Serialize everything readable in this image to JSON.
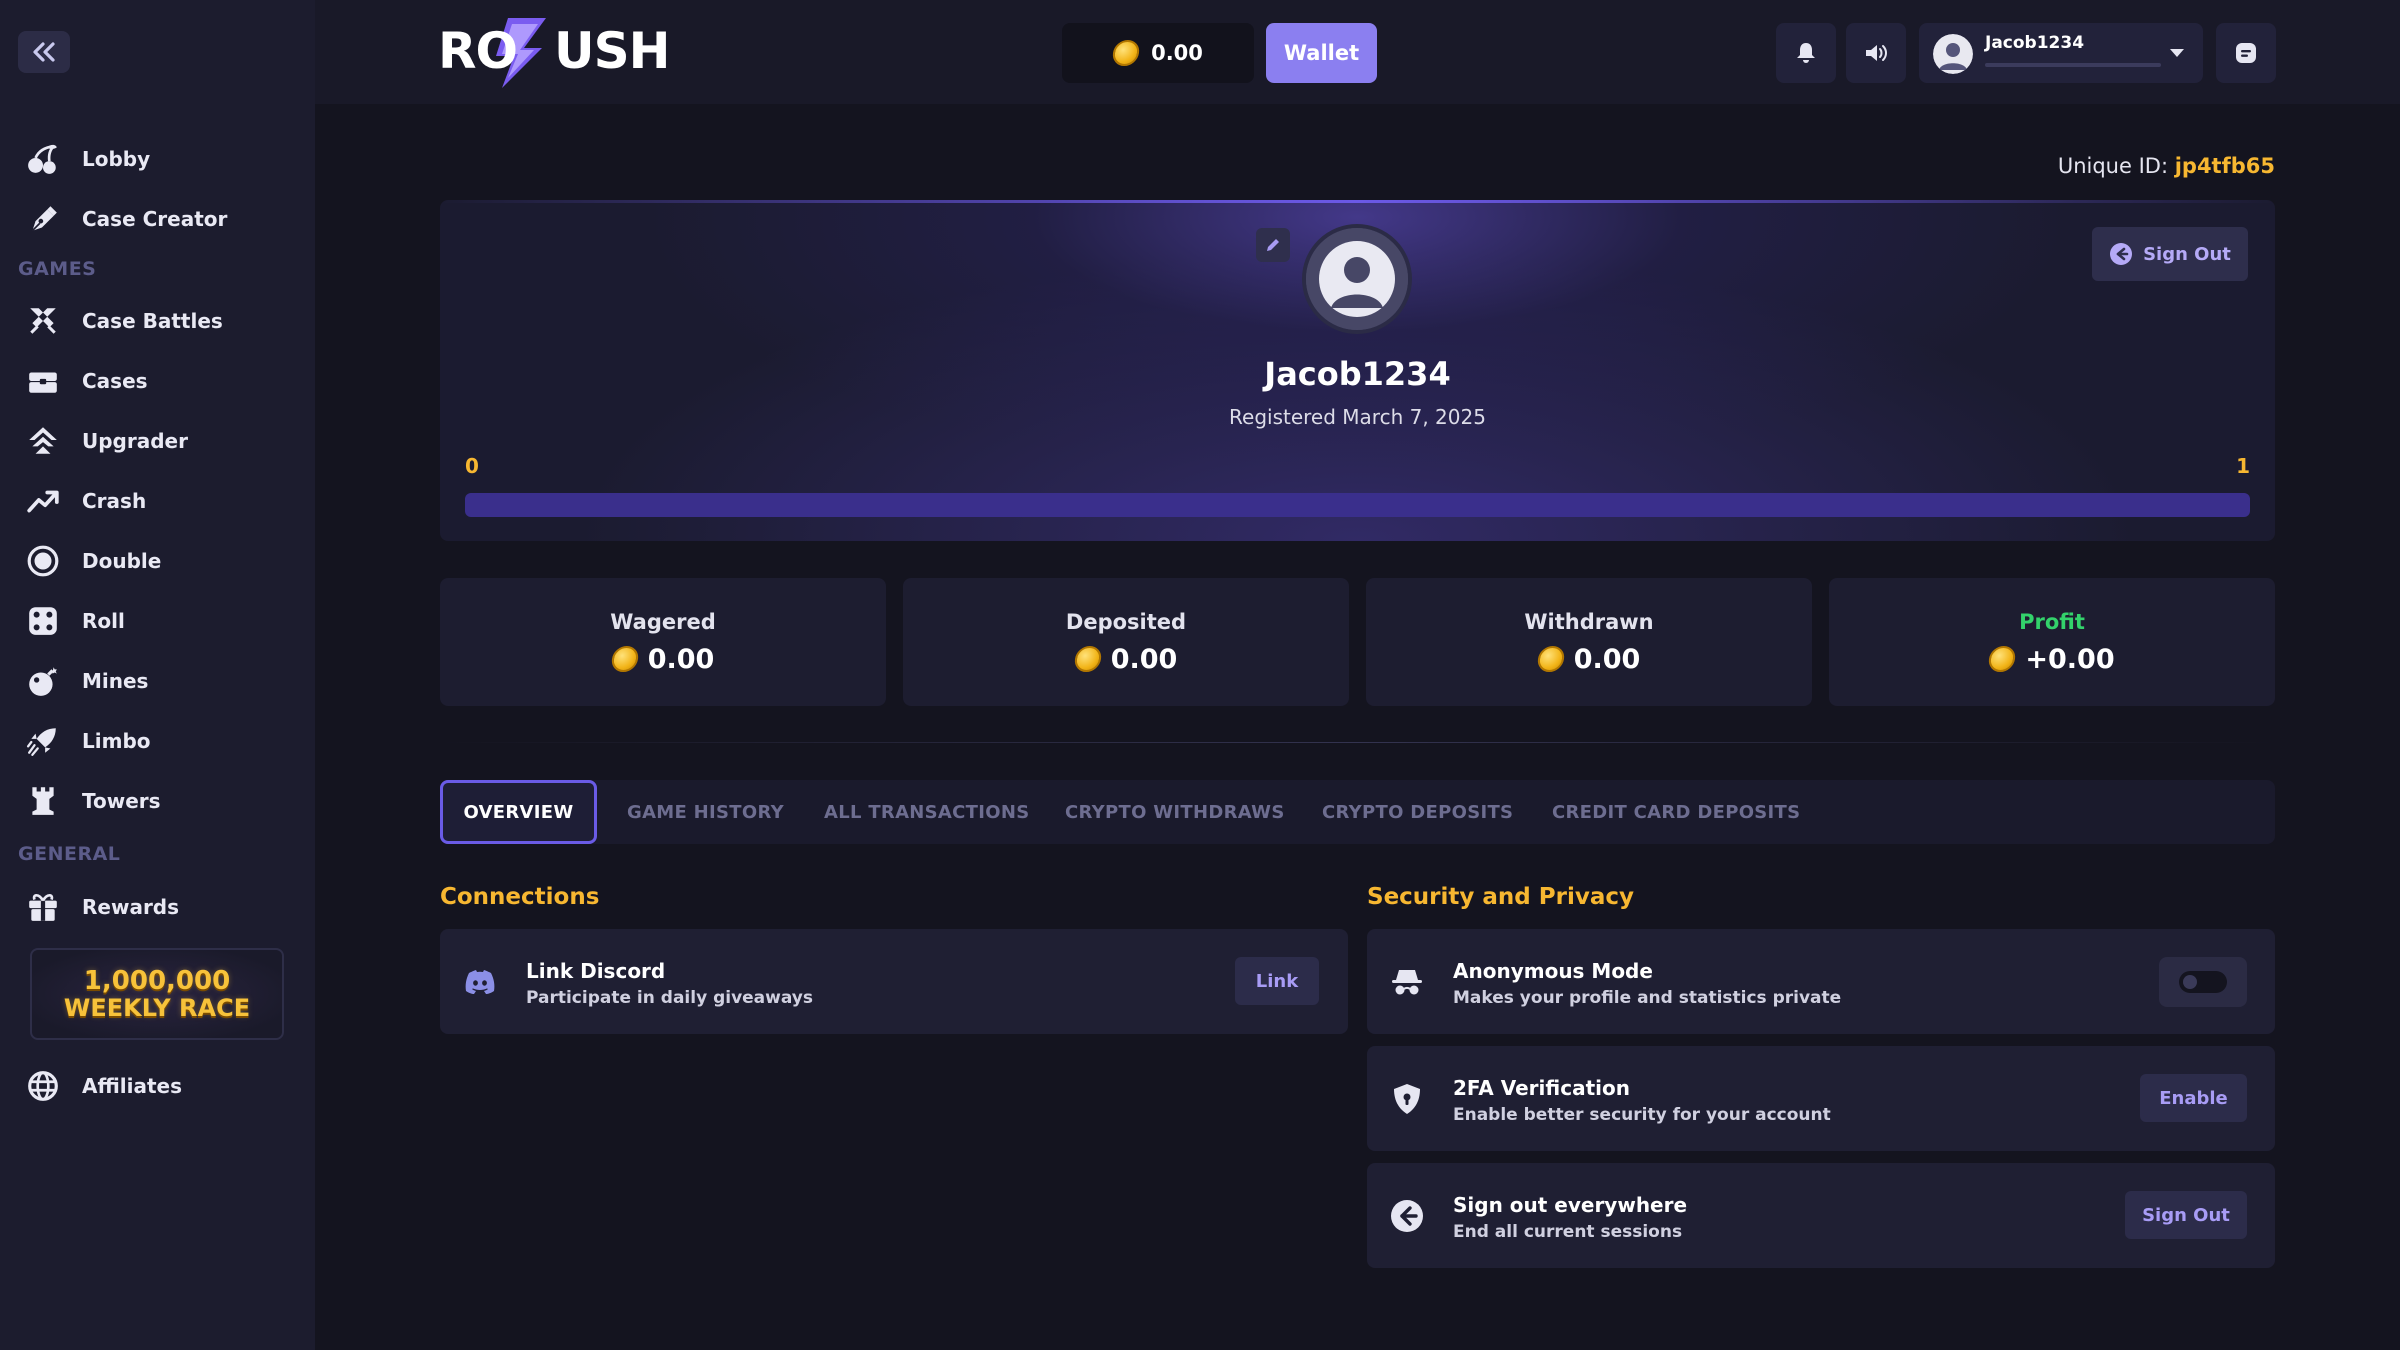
{
  "sidebar": {
    "items_top": [
      {
        "label": "Lobby",
        "icon": "cherry-icon"
      },
      {
        "label": "Case Creator",
        "icon": "pen-icon"
      }
    ],
    "games_heading": "GAMES",
    "games": [
      {
        "label": "Case Battles",
        "icon": "swords-icon"
      },
      {
        "label": "Cases",
        "icon": "chest-icon"
      },
      {
        "label": "Upgrader",
        "icon": "upgrade-icon"
      },
      {
        "label": "Crash",
        "icon": "trend-up-icon"
      },
      {
        "label": "Double",
        "icon": "target-icon"
      },
      {
        "label": "Roll",
        "icon": "dice-icon"
      },
      {
        "label": "Mines",
        "icon": "bomb-icon"
      },
      {
        "label": "Limbo",
        "icon": "rocket-icon"
      },
      {
        "label": "Towers",
        "icon": "tower-icon"
      }
    ],
    "general_heading": "GENERAL",
    "rewards": {
      "label": "Rewards",
      "icon": "gift-icon"
    },
    "race_banner": {
      "line1": "1,000,000",
      "line2": "WEEKLY RACE"
    },
    "affiliates": {
      "label": "Affiliates",
      "icon": "globe-icon"
    }
  },
  "header": {
    "logo": "ROBUSH",
    "balance": "0.00",
    "wallet_label": "Wallet",
    "username": "Jacob1234"
  },
  "profile": {
    "unique_id_label": "Unique ID:",
    "unique_id": "jp4tfb65",
    "username": "Jacob1234",
    "registered": "Registered March 7, 2025",
    "level_start": "0",
    "level_end": "1",
    "level_progress": 1.0,
    "sign_out_label": "Sign Out"
  },
  "stats": [
    {
      "label": "Wagered",
      "value": "0.00"
    },
    {
      "label": "Deposited",
      "value": "0.00"
    },
    {
      "label": "Withdrawn",
      "value": "0.00"
    },
    {
      "label": "Profit",
      "value": "+0.00"
    }
  ],
  "tabs": [
    "OVERVIEW",
    "GAME HISTORY",
    "ALL TRANSACTIONS",
    "CRYPTO WITHDRAWS",
    "CRYPTO DEPOSITS",
    "CREDIT CARD DEPOSITS"
  ],
  "connections": {
    "title": "Connections",
    "discord": {
      "title": "Link Discord",
      "subtitle": "Participate in daily giveaways",
      "button": "Link"
    }
  },
  "security": {
    "title": "Security and Privacy",
    "anonymous": {
      "title": "Anonymous Mode",
      "subtitle": "Makes your profile and statistics private",
      "enabled": false
    },
    "twofa": {
      "title": "2FA Verification",
      "subtitle": "Enable better security for your account",
      "button": "Enable"
    },
    "signout_all": {
      "title": "Sign out everywhere",
      "subtitle": "End all current sessions",
      "button": "Sign Out"
    }
  },
  "colors": {
    "accent": "#8b7ff0",
    "gold": "#f7b731",
    "profit": "#33d26b",
    "bg": "#14141f"
  }
}
